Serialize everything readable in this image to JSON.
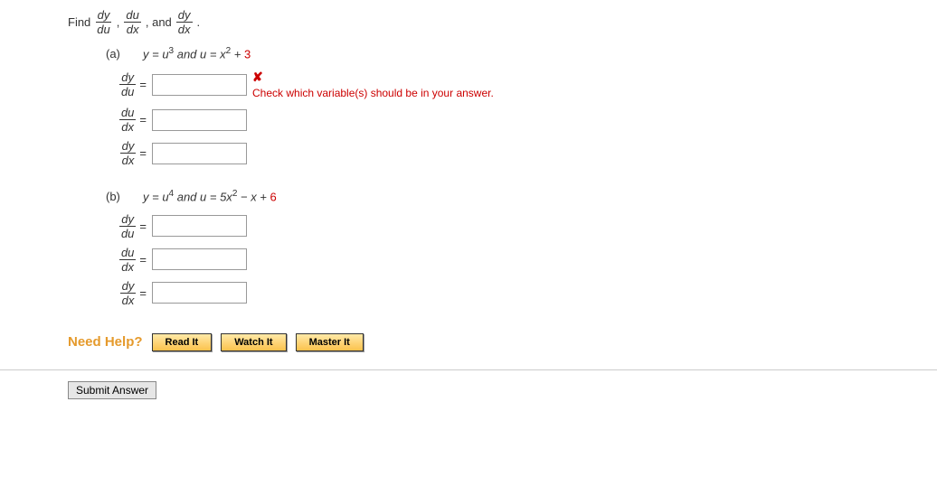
{
  "prompt": {
    "find": "Find",
    "comma": ",",
    "and": ", and",
    "period": "."
  },
  "parts": {
    "a": {
      "label": "(a)",
      "equation_pre": "y = u",
      "exp1": "3",
      "mid": " and u = x",
      "exp2": "2",
      "plus": " + ",
      "constant": "3",
      "feedback": "Check which variable(s) should be in your answer."
    },
    "b": {
      "label": "(b)",
      "equation_pre": "y = u",
      "exp1": "4",
      "mid": " and u = 5x",
      "exp2": "2",
      "minus": " − x + ",
      "constant": "6"
    }
  },
  "derivs": {
    "dy": "dy",
    "du": "du",
    "dx": "dx"
  },
  "equals": "=",
  "help": {
    "label": "Need Help?",
    "read": "Read It",
    "watch": "Watch It",
    "master": "Master It"
  },
  "submit": "Submit Answer"
}
